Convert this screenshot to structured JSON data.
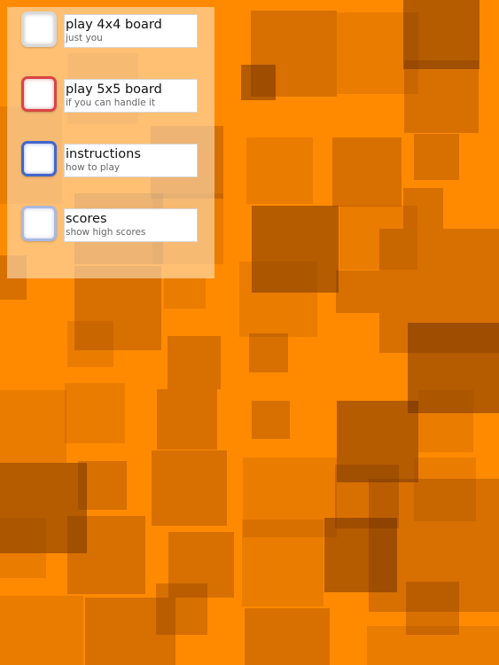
{
  "menu": {
    "items": [
      {
        "title": "play 4x4 board",
        "subtitle": "just you",
        "button_color": "#d9d9d9"
      },
      {
        "title": "play 5x5 board",
        "subtitle": "if you can handle it",
        "button_color": "#d94545"
      },
      {
        "title": "instructions",
        "subtitle": "how to play",
        "button_color": "#4466cc"
      },
      {
        "title": "scores",
        "subtitle": "show high scores",
        "button_color": "#a9b8e0"
      }
    ]
  },
  "colors": {
    "background": "#ff8a00",
    "square_shade": "#6e2d00",
    "panel": "#ffecd2"
  }
}
